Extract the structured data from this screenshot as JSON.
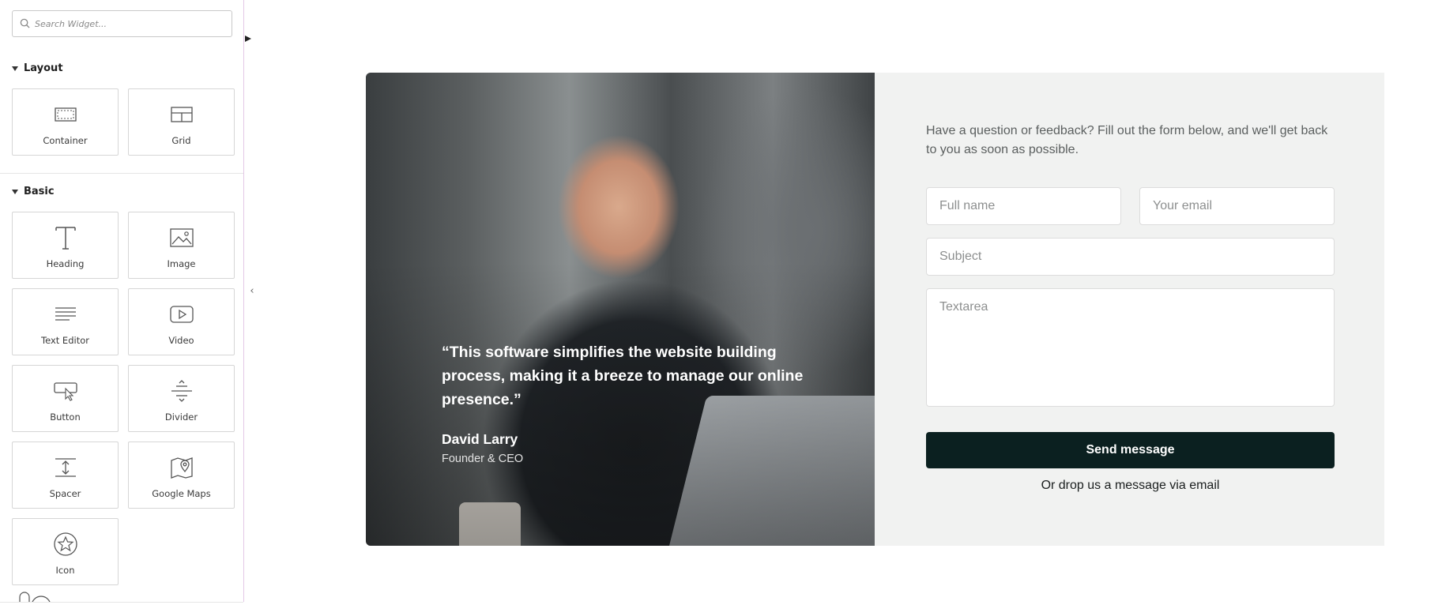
{
  "sidebar": {
    "search_placeholder": "Search Widget...",
    "categories": [
      {
        "name": "Layout",
        "widgets": [
          {
            "label": "Container",
            "icon": "container-icon"
          },
          {
            "label": "Grid",
            "icon": "grid-icon"
          }
        ]
      },
      {
        "name": "Basic",
        "widgets": [
          {
            "label": "Heading",
            "icon": "heading-icon"
          },
          {
            "label": "Image",
            "icon": "image-icon"
          },
          {
            "label": "Text Editor",
            "icon": "text-editor-icon"
          },
          {
            "label": "Video",
            "icon": "video-icon"
          },
          {
            "label": "Button",
            "icon": "button-icon"
          },
          {
            "label": "Divider",
            "icon": "divider-icon"
          },
          {
            "label": "Spacer",
            "icon": "spacer-icon"
          },
          {
            "label": "Google Maps",
            "icon": "google-maps-icon"
          },
          {
            "label": "Icon",
            "icon": "star-icon"
          }
        ]
      }
    ]
  },
  "testimonial": {
    "quote": "“This software simplifies the website building process, making it a breeze to manage our online presence.”",
    "author": "David Larry",
    "role": "Founder & CEO"
  },
  "form": {
    "intro": "Have a question or feedback? Fill out the form below, and we'll get back to you as soon as possible.",
    "full_name_placeholder": "Full name",
    "email_placeholder": "Your email",
    "subject_placeholder": "Subject",
    "textarea_placeholder": "Textarea",
    "submit_label": "Send message",
    "email_link": "Or drop us a message via email"
  },
  "colors": {
    "form_background": "#f1f2f1",
    "button_background": "#0b2020",
    "sidebar_border": "#e3c7e6"
  }
}
